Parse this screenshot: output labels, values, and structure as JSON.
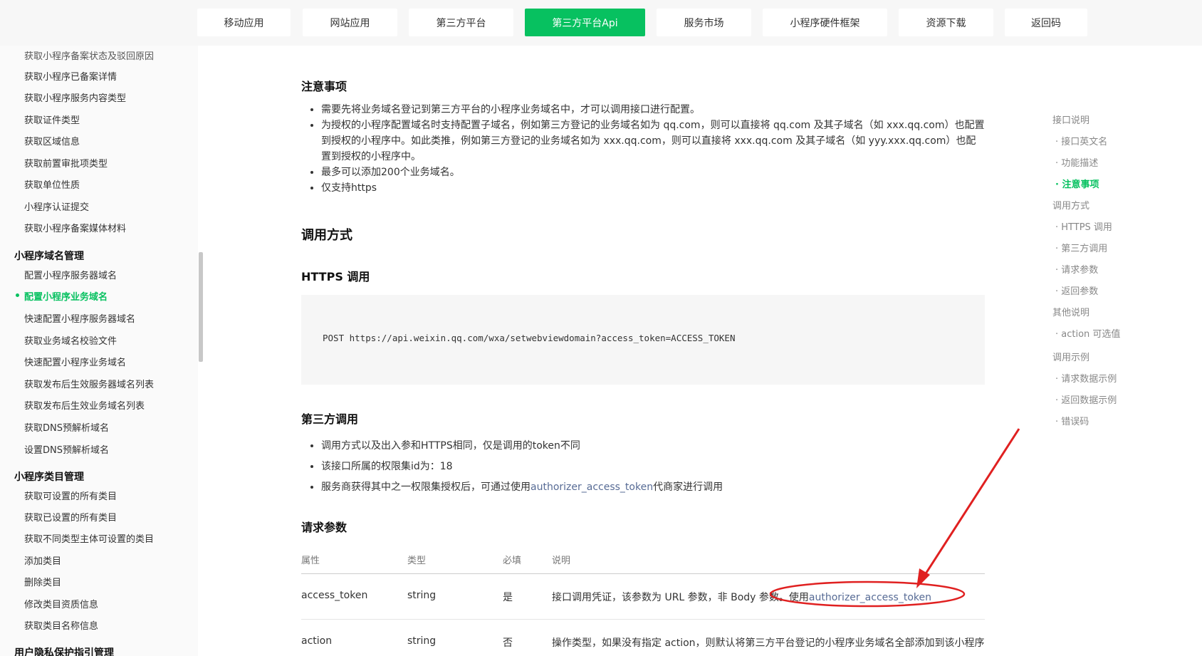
{
  "nav": {
    "tabs": [
      {
        "label": "移动应用"
      },
      {
        "label": "网站应用"
      },
      {
        "label": "第三方平台"
      },
      {
        "label": "第三方平台Api"
      },
      {
        "label": "服务市场"
      },
      {
        "label": "小程序硬件框架"
      },
      {
        "label": "资源下载"
      },
      {
        "label": "返回码"
      }
    ],
    "active_index": 3
  },
  "sidebar": {
    "items": [
      {
        "label": "获取小程序备案状态及驳回原因"
      },
      {
        "label": "获取小程序已备案详情"
      },
      {
        "label": "获取小程序服务内容类型"
      },
      {
        "label": "获取证件类型"
      },
      {
        "label": "获取区域信息"
      },
      {
        "label": "获取前置审批项类型"
      },
      {
        "label": "获取单位性质"
      },
      {
        "label": "小程序认证提交"
      },
      {
        "label": "获取小程序备案媒体材料"
      }
    ],
    "group_domain": {
      "title": "小程序域名管理",
      "items": [
        {
          "label": "配置小程序服务器域名"
        },
        {
          "label": "配置小程序业务域名"
        },
        {
          "label": "快速配置小程序服务器域名"
        },
        {
          "label": "获取业务域名校验文件"
        },
        {
          "label": "快速配置小程序业务域名"
        },
        {
          "label": "获取发布后生效服务器域名列表"
        },
        {
          "label": "获取发布后生效业务域名列表"
        },
        {
          "label": "获取DNS预解析域名"
        },
        {
          "label": "设置DNS预解析域名"
        }
      ]
    },
    "group_category": {
      "title": "小程序类目管理",
      "items": [
        {
          "label": "获取可设置的所有类目"
        },
        {
          "label": "获取已设置的所有类目"
        },
        {
          "label": "获取不同类型主体可设置的类目"
        },
        {
          "label": "添加类目"
        },
        {
          "label": "删除类目"
        },
        {
          "label": "修改类目资质信息"
        },
        {
          "label": "获取类目名称信息"
        }
      ]
    },
    "group_privacy": {
      "title": "用户隐私保护指引管理"
    }
  },
  "content": {
    "notes": {
      "heading": "注意事项",
      "items": [
        "需要先将业务域名登记到第三方平台的小程序业务域名中，才可以调用接口进行配置。",
        "为授权的小程序配置域名时支持配置子域名，例如第三方登记的业务域名如为 qq.com，则可以直接将 qq.com 及其子域名（如 xxx.qq.com）也配置到授权的小程序中。如此类推，例如第三方登记的业务域名如为 xxx.qq.com，则可以直接将 xxx.qq.com 及其子域名（如 yyy.xxx.qq.com）也配置到授权的小程序中。",
        "最多可以添加200个业务域名。",
        "仅支持https"
      ]
    },
    "call_method": {
      "heading": "调用方式"
    },
    "https_call": {
      "heading": "HTTPS 调用",
      "code": "POST https://api.weixin.qq.com/wxa/setwebviewdomain?access_token=ACCESS_TOKEN"
    },
    "third_party": {
      "heading": "第三方调用",
      "item1": "调用方式以及出入参和HTTPS相同，仅是调用的token不同",
      "item2": "该接口所属的权限集id为：18",
      "item3_prefix": "服务商获得其中之一权限集授权后，可通过使用",
      "item3_link": "authorizer_access_token",
      "item3_suffix": "代商家进行调用"
    },
    "params": {
      "heading": "请求参数",
      "columns": [
        "属性",
        "类型",
        "必填",
        "说明"
      ],
      "rows": [
        {
          "name": "access_token",
          "type": "string",
          "required": "是",
          "desc_prefix": "接口调用凭证，该参数为 URL 参数，非 Body 参数。使用",
          "desc_link": "authorizer_access_token"
        },
        {
          "name": "action",
          "type": "string",
          "required": "否",
          "desc_prefix": "操作类型，如果没有指定 action，则默认将第三方平台登记的小程序业务域名全部添加到该小程序"
        }
      ]
    }
  },
  "toc": {
    "items": [
      {
        "label": "接口说明",
        "level": 1
      },
      {
        "label": "接口英文名",
        "level": 2
      },
      {
        "label": "功能描述",
        "level": 2
      },
      {
        "label": "注意事项",
        "level": 2,
        "active": true
      },
      {
        "label": "调用方式",
        "level": 1
      },
      {
        "label": "HTTPS 调用",
        "level": 2
      },
      {
        "label": "第三方调用",
        "level": 2
      },
      {
        "label": "请求参数",
        "level": 2
      },
      {
        "label": "返回参数",
        "level": 2
      },
      {
        "label": "其他说明",
        "level": 1
      },
      {
        "label": "action 可选值",
        "level": 2
      },
      {
        "label": "调用示例",
        "level": 1
      },
      {
        "label": "请求数据示例",
        "level": 2
      },
      {
        "label": "返回数据示例",
        "level": 2
      },
      {
        "label": "错误码",
        "level": 2
      }
    ]
  },
  "annotation": {
    "color": "#e02020",
    "shapes": [
      "ellipse",
      "arrow"
    ]
  }
}
